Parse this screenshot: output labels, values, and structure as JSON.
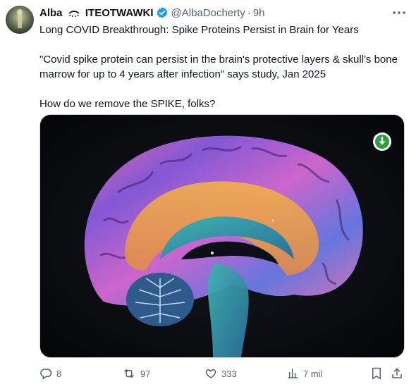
{
  "author": {
    "name_first": "Alba",
    "name_second": "ITEOTWAWKI",
    "handle": "@AlbaDocherty",
    "separator": "·",
    "time": "9h"
  },
  "tweet": {
    "line1": "Long COVID Breakthrough:  Spike Proteins Persist in Brain for Years",
    "line2": "\"Covid spike protein can persist in the brain's protective layers & skull's bone marrow for up to 4 years after infection\" says study, Jan 2025",
    "line3": "How do we remove the SPIKE, folks?"
  },
  "actions": {
    "replies": "8",
    "reposts": "97",
    "likes": "333",
    "views": "7 mil"
  },
  "colors": {
    "verified": "#1d9bf0",
    "muted": "#536471",
    "download_green": "#2e9e3e"
  },
  "icons": [
    "more-icon",
    "eye-icon",
    "verified-icon",
    "download-icon",
    "reply-icon",
    "repost-icon",
    "like-icon",
    "views-icon",
    "bookmark-icon",
    "share-icon"
  ]
}
